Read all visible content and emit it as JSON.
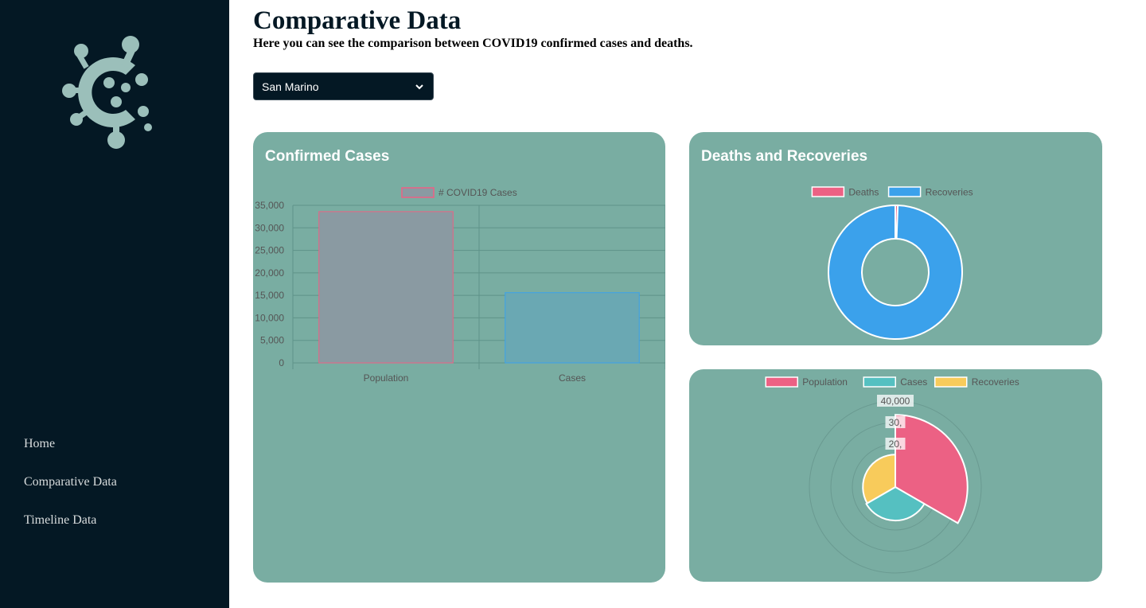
{
  "sidebar": {
    "logo": {
      "icon": "virus-logo-icon",
      "color": "#9bbfba"
    },
    "nav": [
      {
        "label": "Home"
      },
      {
        "label": "Comparative Data"
      },
      {
        "label": "Timeline Data"
      }
    ]
  },
  "header": {
    "title": "Comparative Data",
    "subtitle": "Here you can see the comparison between COVID19 confirmed cases and deaths."
  },
  "country_select": {
    "value": "San Marino"
  },
  "colors": {
    "sidebar_bg": "#041824",
    "card_bg": "#79ada2",
    "pink": "#ec6184",
    "blue": "#3ba1eb",
    "teal": "#55c0c1",
    "yellow": "#f8cb5b",
    "grey_bar": "#8a9aa2"
  },
  "cards": {
    "confirmed": {
      "title": "Confirmed Cases"
    },
    "deaths": {
      "title": "Deaths and Recoveries"
    }
  },
  "chart_data": [
    {
      "type": "bar",
      "title": "",
      "categories": [
        "Population",
        "Cases"
      ],
      "series": [
        {
          "name": "# COVID19 Cases",
          "values": [
            33600,
            15600
          ]
        }
      ],
      "ylim": [
        0,
        35000
      ],
      "y_ticks": [
        "0",
        "5,000",
        "10,000",
        "15,000",
        "20,000",
        "25,000",
        "30,000",
        "35,000"
      ],
      "bar_colors": [
        "#8a9aa2",
        "#6aa8b3"
      ],
      "bar_borders": [
        "#ec6184",
        "#3ba1eb"
      ],
      "grid": true,
      "legend": "top"
    },
    {
      "type": "pie",
      "variant": "doughnut",
      "labels": [
        "Deaths",
        "Recoveries"
      ],
      "values": [
        90,
        15100
      ],
      "colors": [
        "#ec6184",
        "#3ba1eb"
      ],
      "legend": "top"
    },
    {
      "type": "pie",
      "variant": "polar-area",
      "labels": [
        "Population",
        "Cases",
        "Recoveries"
      ],
      "values": [
        33600,
        15600,
        15100
      ],
      "colors": [
        "#ec6184",
        "#55c0c1",
        "#f8cb5b"
      ],
      "r_ticks": [
        "20,",
        "30,",
        "40,000"
      ],
      "rlim": [
        0,
        40000
      ],
      "legend": "top"
    }
  ]
}
